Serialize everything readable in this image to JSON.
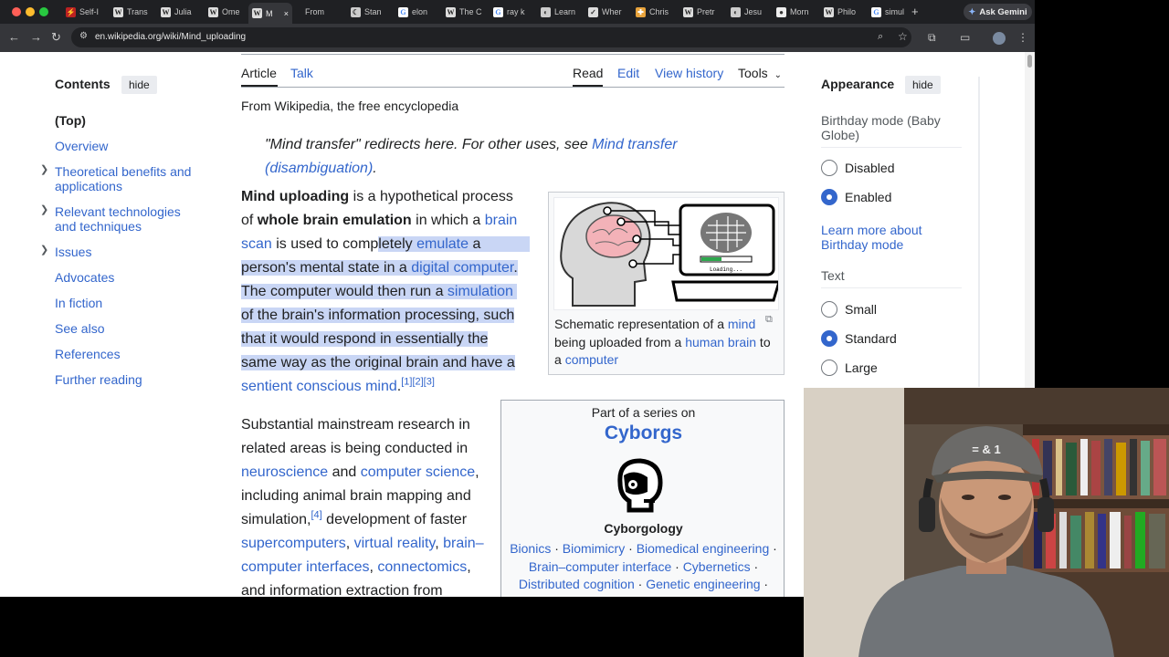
{
  "browser": {
    "tabs": [
      {
        "label": "Self-I",
        "icon": "bolt-icon",
        "x": 68,
        "w": 44
      },
      {
        "label": "Trans",
        "icon": "wikipedia-icon",
        "x": 120,
        "w": 44
      },
      {
        "label": "Julia",
        "icon": "wikipedia-icon",
        "x": 172,
        "w": 44
      },
      {
        "label": "Ome",
        "icon": "wikipedia-icon",
        "x": 224,
        "w": 44
      },
      {
        "label": "M",
        "icon": "wikipedia-icon",
        "x": 272,
        "w": 48,
        "active": true
      },
      {
        "label": "From",
        "icon": "",
        "x": 330,
        "w": 40
      },
      {
        "label": "Stan",
        "icon": "moon-icon",
        "x": 380,
        "w": 44
      },
      {
        "label": "elon",
        "icon": "google-icon",
        "x": 432,
        "w": 44
      },
      {
        "label": "The C",
        "icon": "wikipedia-icon",
        "x": 484,
        "w": 44
      },
      {
        "label": "ray k",
        "icon": "google-icon",
        "x": 536,
        "w": 44
      },
      {
        "label": "Learn",
        "icon": "globe-icon",
        "x": 588,
        "w": 44
      },
      {
        "label": "Wher",
        "icon": "check-icon",
        "x": 640,
        "w": 44
      },
      {
        "label": "Chris",
        "icon": "cross-icon",
        "x": 692,
        "w": 44
      },
      {
        "label": "Pretr",
        "icon": "wikipedia-icon",
        "x": 744,
        "w": 44
      },
      {
        "label": "Jesu",
        "icon": "globe-icon",
        "x": 796,
        "w": 44
      },
      {
        "label": "Morn",
        "icon": "chat-icon",
        "x": 846,
        "w": 44
      },
      {
        "label": "Philo",
        "icon": "wikipedia-icon",
        "x": 898,
        "w": 44
      },
      {
        "label": "simul",
        "icon": "google-icon",
        "x": 950,
        "w": 44
      }
    ],
    "new_tab": "+",
    "gemini_label": "Ask Gemini",
    "url": "en.wikipedia.org/wiki/Mind_uploading",
    "colors": {
      "tabbar": "#1f2023",
      "toolbar": "#35363a",
      "link": "#3366cc",
      "highlight": "#c9d6f5"
    }
  },
  "toc": {
    "title": "Contents",
    "hide": "hide",
    "items": [
      "(Top)",
      "Overview",
      "Theoretical benefits and",
      "applications",
      "Relevant technologies",
      "and techniques",
      "Issues",
      "Advocates",
      "In fiction",
      "See also",
      "References",
      "Further reading"
    ]
  },
  "article": {
    "tabs": {
      "article": "Article",
      "talk": "Talk",
      "read": "Read",
      "edit": "Edit",
      "history": "View history",
      "tools": "Tools"
    },
    "from": "From Wikipedia, the free encyclopedia",
    "hatnote": {
      "pre": "\"Mind transfer\" redirects here. For other uses, see ",
      "link": "Mind transfer (disambiguation)",
      "post": "."
    },
    "p1": {
      "l1a": "Mind uploading",
      "l1b": " is a hypothetical process",
      "l2a": "of ",
      "l2b": "whole brain emulation",
      "l2c": " in which a ",
      "l2d": "brain",
      "l3a": "scan",
      "l3b": " is used to comp",
      "l3c": "letely ",
      "l3d": "emulate",
      "l3e": " a",
      "l4a": "person's mental state in a ",
      "l4b": "digital computer",
      "l4c": ".",
      "l5a": "The computer would then run a ",
      "l5b": "simulation",
      "l6": "of the brain's information processing, such",
      "l7": "that it would respond in essentially the",
      "l8": "same way as the original brain and have a",
      "l9a": "sentient conscious mind",
      "l9b": ".",
      "refs": "[1][2][3]"
    },
    "p2": {
      "l1": "Substantial mainstream research in",
      "l2": "related areas is being conducted in",
      "l3a": "neuroscience",
      "l3b": " and ",
      "l3c": "computer science",
      "l3d": ",",
      "l4": "including animal brain mapping and",
      "l5a": "simulation,",
      "l5ref": "[4]",
      "l5b": " development of faster",
      "l6a": "supercomputers",
      "l6b": ", ",
      "l6c": "virtual reality",
      "l6d": ", ",
      "l6e": "brain–",
      "l7a": "computer interfaces",
      "l7b": ", ",
      "l7c": "connectomics",
      "l7d": ",",
      "l8": "and information extraction from"
    },
    "figure": {
      "caption_pre": "Schematic representation of a ",
      "caption_mind": "mind",
      "caption_mid": " being uploaded from a ",
      "caption_brain": "human brain",
      "caption_to": " to a ",
      "caption_computer": "computer",
      "loading": "Loading..."
    },
    "infobox": {
      "series": "Part of a series on",
      "title": "Cyborgs",
      "subtitle": "Cyborgology",
      "line1": [
        "Bionics",
        "Biomimicry",
        "Biomedical engineering"
      ],
      "line2": [
        "Brain–computer interface",
        "Cybernetics"
      ],
      "line3": [
        "Distributed cognition",
        "Genetic engineering"
      ],
      "sep": " · "
    }
  },
  "appearance": {
    "title": "Appearance",
    "hide": "hide",
    "birthday_label": "Birthday mode (Baby",
    "birthday_label2": "Globe)",
    "disabled": "Disabled",
    "enabled": "Enabled",
    "learn_more": "Learn more about",
    "learn_more2": "Birthday mode",
    "text_label": "Text",
    "small": "Small",
    "standard": "Standard",
    "large": "Large"
  }
}
